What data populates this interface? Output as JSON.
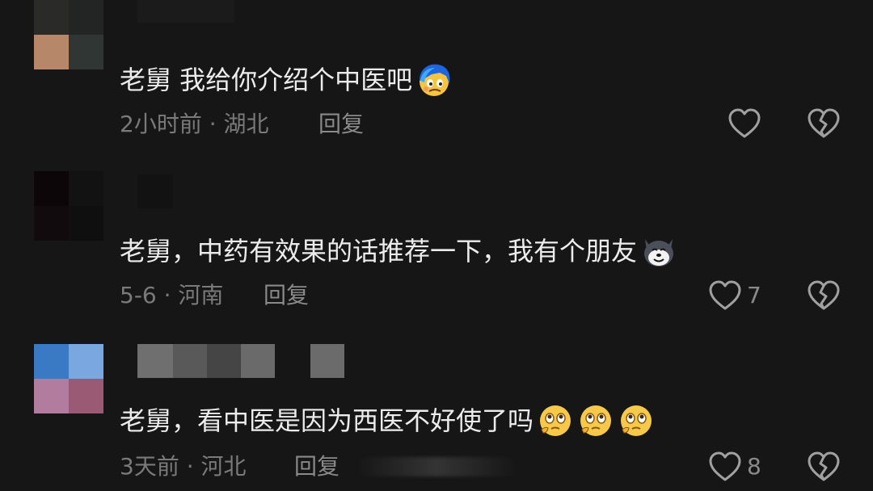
{
  "comments": [
    {
      "text": "老舅 我给你介绍个中医吧",
      "emoji": "face-with-blue-hair-emoji",
      "meta": "2小时前 · 湖北",
      "reply_label": "回复",
      "like_count": ""
    },
    {
      "text": "老舅，中药有效果的话推荐一下，我有个朋友",
      "emoji": "husky-dog-emoji",
      "meta": "5-6 · 河南",
      "reply_label": "回复",
      "like_count": "7"
    },
    {
      "text": "老舅，看中医是因为西医不好使了吗",
      "emoji": "pleading-face-emoji",
      "meta": "3天前 · 河北",
      "reply_label": "回复",
      "like_count": "8"
    }
  ],
  "colors": {
    "background": "#161616",
    "text": "#ececec",
    "meta": "#7a7a7a",
    "icon": "#a0a0a0"
  }
}
